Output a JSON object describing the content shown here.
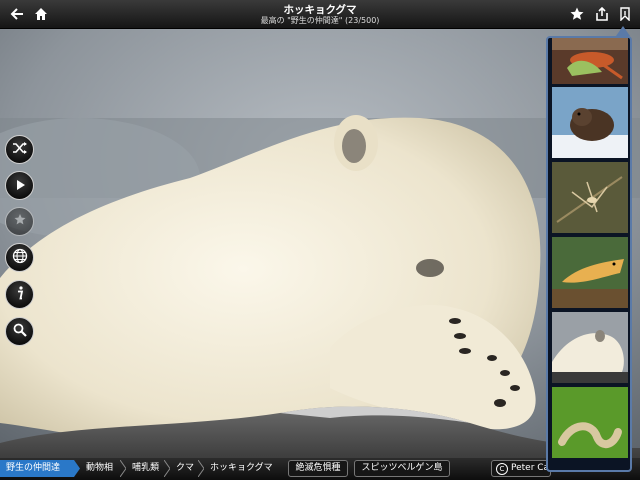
{
  "header": {
    "title": "ホッキョクグマ",
    "subtitle": "最高の \"野生の仲間達\" (23/500)",
    "icons": [
      "back-arrow-icon",
      "home-icon",
      "star-icon",
      "share-icon",
      "bookmark-icon"
    ]
  },
  "side_controls": [
    "shuffle-icon",
    "play-icon",
    "magic-star-icon",
    "globe-icon",
    "info-icon",
    "search-icon"
  ],
  "thumbnails": [
    "frog",
    "beaver-in-snow",
    "insect-on-branch",
    "yellow-fish",
    "polar-bear",
    "caterpillar"
  ],
  "breadcrumbs": {
    "items": [
      "野生の仲間達",
      "動物相",
      "哺乳類",
      "クマ",
      "ホッキョクグマ"
    ],
    "tags": [
      "絶滅危惧種",
      "スピッツベルゲン島"
    ],
    "credit_symbol": "C",
    "credit": "Peter Cairns"
  },
  "colors": {
    "accent": "#2a78c8",
    "panel_border": "#5a7aa8"
  }
}
